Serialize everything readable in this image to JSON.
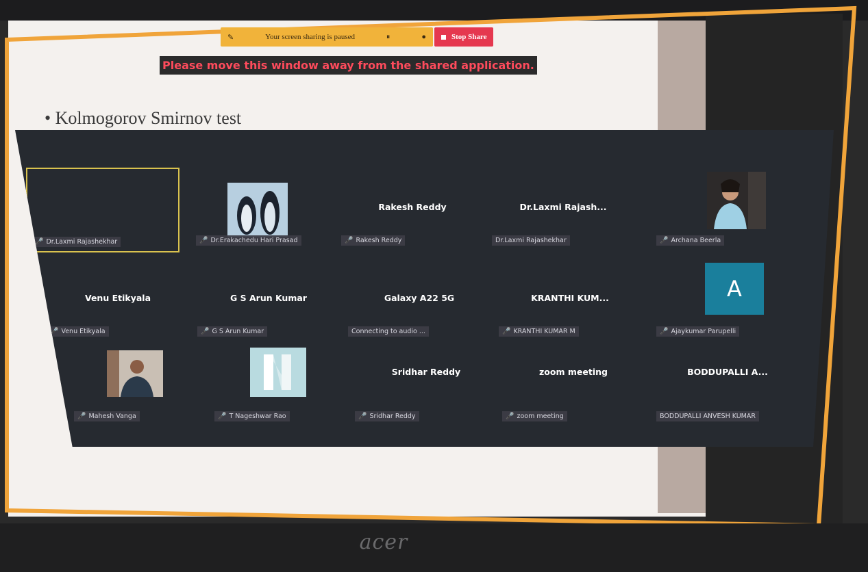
{
  "brand": "acer",
  "share_toolbar": {
    "paused_text": "Your screen sharing is paused",
    "stop_label": "Stop Share"
  },
  "warning": "Please move this window away from the shared application.",
  "slide": {
    "title": "• Kolmogorov Smirnov test"
  },
  "participants": [
    {
      "center_name": "",
      "label": "Dr.Laxmi Rajashekhar",
      "muted": true,
      "active": true,
      "avatar": "none"
    },
    {
      "center_name": "",
      "label": "Dr.Erakachedu Hari Prasad",
      "muted": true,
      "active": false,
      "avatar": "penguins-photo"
    },
    {
      "center_name": "Rakesh Reddy",
      "label": "Rakesh Reddy",
      "muted": true,
      "active": false,
      "avatar": "none"
    },
    {
      "center_name": "Dr.Laxmi  Rajash...",
      "label": "Dr.Laxmi Rajashekhar",
      "muted": false,
      "active": false,
      "avatar": "none"
    },
    {
      "center_name": "",
      "label": "Archana Beerla",
      "muted": true,
      "active": false,
      "avatar": "woman-photo"
    },
    {
      "center_name": "Venu Etikyala",
      "label": "Venu Etikyala",
      "muted": true,
      "active": false,
      "avatar": "none"
    },
    {
      "center_name": "G S Arun Kumar",
      "label": "G S Arun Kumar",
      "muted": true,
      "active": false,
      "avatar": "none"
    },
    {
      "center_name": "Galaxy A22 5G",
      "label": "Connecting to audio ...",
      "muted": false,
      "active": false,
      "avatar": "none"
    },
    {
      "center_name": "KRANTHI KUM...",
      "label": "KRANTHI KUMAR M",
      "muted": true,
      "active": false,
      "avatar": "none"
    },
    {
      "center_name": "",
      "label": "Ajaykumar Parupelli",
      "muted": true,
      "active": false,
      "avatar": "letter-A"
    },
    {
      "center_name": "",
      "label": "Mahesh Vanga",
      "muted": true,
      "active": false,
      "avatar": "man-photo"
    },
    {
      "center_name": "",
      "label": "T Nageshwar Rao",
      "muted": true,
      "active": false,
      "avatar": "abstract-photo"
    },
    {
      "center_name": "Sridhar Reddy",
      "label": "Sridhar Reddy",
      "muted": true,
      "active": false,
      "avatar": "none"
    },
    {
      "center_name": "zoom meeting",
      "label": "zoom meeting",
      "muted": true,
      "active": false,
      "avatar": "none"
    },
    {
      "center_name": "BODDUPALLI A...",
      "label": "BODDUPALLI ANVESH KUMAR",
      "muted": false,
      "active": false,
      "avatar": "none"
    }
  ],
  "avatar_letter": "A",
  "colors": {
    "share_border": "#f0a43a",
    "gallery_bg": "#262a30",
    "active_border": "#d9c24e",
    "mute_red": "#ff4b5c",
    "stop_red": "#e5384f",
    "paused_yellow": "#f1b33a",
    "avatar_teal": "#1a7f9c"
  }
}
